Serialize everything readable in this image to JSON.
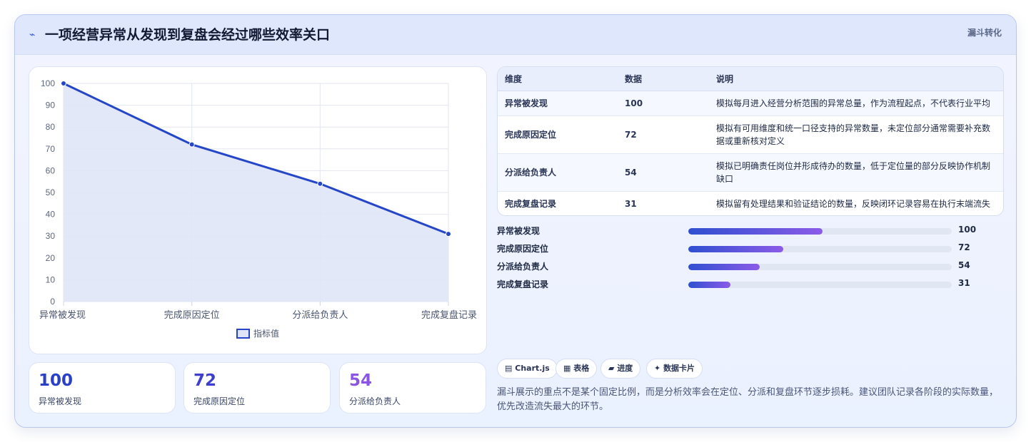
{
  "header": {
    "icon": "lightning-icon",
    "title": "一项经营异常从发现到复盘会经过哪些效率关口",
    "tag": "漏斗转化"
  },
  "chart_data": {
    "type": "area",
    "categories": [
      "异常被发现",
      "完成原因定位",
      "分派给负责人",
      "完成复盘记录"
    ],
    "series": [
      {
        "name": "指标值",
        "values": [
          100,
          72,
          54,
          31
        ]
      }
    ],
    "ylim": [
      0,
      100
    ],
    "yticks": [
      "0",
      "10",
      "20",
      "30",
      "40",
      "50",
      "60",
      "70",
      "80",
      "90",
      "100"
    ],
    "legend_position": "bottom",
    "grid": true,
    "line_color": "#2446c7",
    "fill_color": "#dfe5f7"
  },
  "stats": [
    {
      "value": "100",
      "label": "异常被发现",
      "color": "#2a40c6"
    },
    {
      "value": "72",
      "label": "完成原因定位",
      "color": "#3f3fcf"
    },
    {
      "value": "54",
      "label": "分派给负责人",
      "color": "#8a55e6"
    }
  ],
  "table": {
    "headers": [
      "维度",
      "数据",
      "说明"
    ],
    "rows": [
      {
        "dim": "异常被发现",
        "value": "100",
        "desc": "模拟每月进入经营分析范围的异常总量，作为流程起点，不代表行业平均"
      },
      {
        "dim": "完成原因定位",
        "value": "72",
        "desc": "模拟有可用维度和统一口径支持的异常数量，未定位部分通常需要补充数据或重新核对定义"
      },
      {
        "dim": "分派给负责人",
        "value": "54",
        "desc": "模拟已明确责任岗位并形成待办的数量，低于定位量的部分反映协作机制缺口"
      },
      {
        "dim": "完成复盘记录",
        "value": "31",
        "desc": "模拟留有处理结果和验证结论的数量，反映闭环记录容易在执行末端流失"
      }
    ]
  },
  "progress": {
    "max": 100,
    "rows": [
      {
        "label": "异常被发现",
        "value": 100,
        "display": "100",
        "fill_fraction": 0.51
      },
      {
        "label": "完成原因定位",
        "value": 72,
        "display": "72",
        "fill_fraction": 0.36
      },
      {
        "label": "分派给负责人",
        "value": 54,
        "display": "54",
        "fill_fraction": 0.27
      },
      {
        "label": "完成复盘记录",
        "value": 31,
        "display": "31",
        "fill_fraction": 0.16
      }
    ]
  },
  "chips": [
    {
      "icon": "chart-icon",
      "glyph": "▤",
      "label": "Chart.js"
    },
    {
      "icon": "table-icon",
      "glyph": "▦",
      "label": "表格"
    },
    {
      "icon": "progress-icon",
      "glyph": "▰",
      "label": "进度"
    },
    {
      "icon": "sparkle-icon",
      "glyph": "✦",
      "label": "数据卡片"
    }
  ],
  "note": "漏斗展示的重点不是某个固定比例，而是分析效率会在定位、分派和复盘环节逐步损耗。建议团队记录各阶段的实际数量，优先改造流失最大的环节。"
}
